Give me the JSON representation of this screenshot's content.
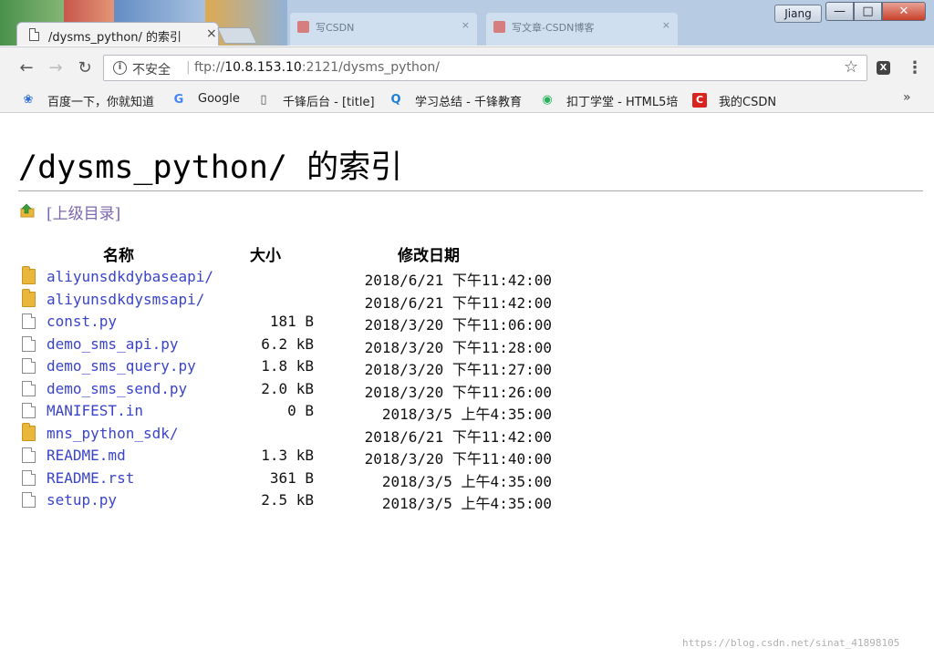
{
  "window": {
    "user": "Jiang",
    "minimize": "—",
    "maximize": "□",
    "close": "✕"
  },
  "tabs": {
    "active_title": "/dysms_python/ 的索引",
    "close": "×",
    "ghost": [
      "写CSDN",
      "写文章-CSDN博客"
    ]
  },
  "toolbar": {
    "back": "←",
    "forward": "→",
    "reload": "↻",
    "security_label": "不安全",
    "url_scheme": "ftp://",
    "url_host": "10.8.153.10",
    "url_rest": ":2121/dysms_python/",
    "star": "☆",
    "menu": "⋮"
  },
  "bookmarks": [
    {
      "label": "百度一下，你就知道",
      "icon": "paw-icon",
      "color": "#2d6cdf"
    },
    {
      "label": "Google",
      "icon": "google-icon",
      "color": "#4285f4"
    },
    {
      "label": "千锋后台 - [title]",
      "icon": "page-icon",
      "color": "#555555"
    },
    {
      "label": "学习总结 - 千锋教育",
      "icon": "q-icon",
      "color": "#1e7fd6"
    },
    {
      "label": "扣丁学堂 - HTML5培",
      "icon": "circle-icon",
      "color": "#27b35a"
    },
    {
      "label": "我的CSDN",
      "icon": "csdn-icon",
      "color": "#d9231f"
    }
  ],
  "bookmarks_overflow": "»",
  "page": {
    "title": "/dysms_python/ 的索引",
    "up_link": "[上级目录]",
    "columns": {
      "name": "名称",
      "size": "大小",
      "date": "修改日期"
    },
    "files": [
      {
        "name": "aliyunsdkdybaseapi/",
        "size": "",
        "date": "2018/6/21 下午11:42:00",
        "type": "folder"
      },
      {
        "name": "aliyunsdkdysmsapi/",
        "size": "",
        "date": "2018/6/21 下午11:42:00",
        "type": "folder"
      },
      {
        "name": "const.py",
        "size": "181 B",
        "date": "2018/3/20 下午11:06:00",
        "type": "file"
      },
      {
        "name": "demo_sms_api.py",
        "size": "6.2 kB",
        "date": "2018/3/20 下午11:28:00",
        "type": "file"
      },
      {
        "name": "demo_sms_query.py",
        "size": "1.8 kB",
        "date": "2018/3/20 下午11:27:00",
        "type": "file"
      },
      {
        "name": "demo_sms_send.py",
        "size": "2.0 kB",
        "date": "2018/3/20 下午11:26:00",
        "type": "file"
      },
      {
        "name": "MANIFEST.in",
        "size": "0 B",
        "date": "2018/3/5 上午4:35:00",
        "type": "file"
      },
      {
        "name": "mns_python_sdk/",
        "size": "",
        "date": "2018/6/21 下午11:42:00",
        "type": "folder"
      },
      {
        "name": "README.md",
        "size": "1.3 kB",
        "date": "2018/3/20 下午11:40:00",
        "type": "file"
      },
      {
        "name": "README.rst",
        "size": "361 B",
        "date": "2018/3/5 上午4:35:00",
        "type": "file"
      },
      {
        "name": "setup.py",
        "size": "2.5 kB",
        "date": "2018/3/5 上午4:35:00",
        "type": "file"
      }
    ]
  },
  "watermark": "https://blog.csdn.net/sinat_41898105",
  "colors": {
    "link": "#3a44c9",
    "visited_link": "#7a67b0",
    "folder": "#e8b73c",
    "close_button": "#c8412b"
  }
}
